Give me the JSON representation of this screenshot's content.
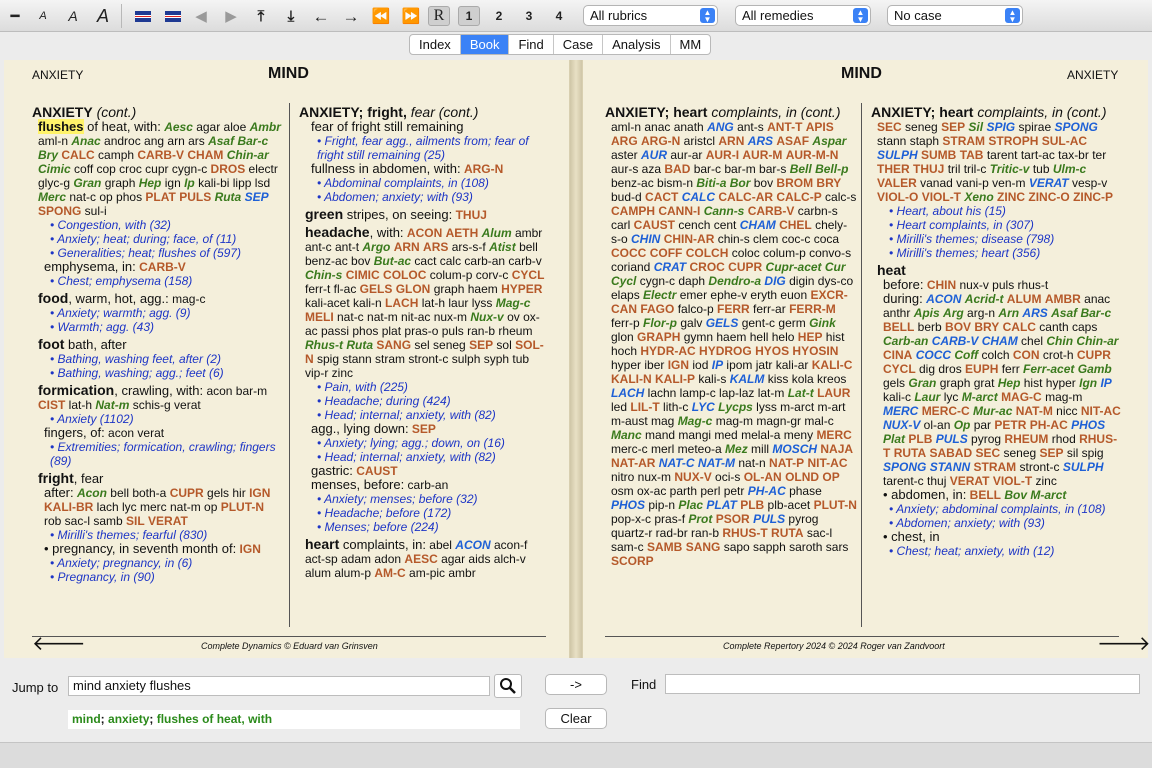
{
  "toolbar": {
    "sel_rubrics": "All rubrics",
    "sel_remedies": "All remedies",
    "sel_case": "No case",
    "nums": [
      "1",
      "2",
      "3",
      "4"
    ],
    "r_label": "R",
    "icons": [
      "minus-icon",
      "font-small-icon",
      "font-medium-icon",
      "font-large-icon",
      "flag-en-icon",
      "flag-en-alt-icon",
      "back-icon",
      "forward-icon",
      "top-icon",
      "bottom-icon",
      "left-arrow-icon",
      "right-arrow-icon",
      "double-left-icon",
      "double-right-icon"
    ]
  },
  "tabs": [
    "Index",
    "Book",
    "Find",
    "Case",
    "Analysis",
    "MM"
  ],
  "active_tab": "Book",
  "left_page": {
    "running_head": "ANXIETY",
    "title": "MIND",
    "footer": "Complete Dynamics © Eduard van Grinsven"
  },
  "right_page": {
    "running_head": "ANXIETY",
    "title": "MIND",
    "footer": "Complete Repertory 2024 © 2024 Roger van Zandvoort"
  },
  "cols": [
    [
      {
        "t": "rb",
        "head": "ANXIETY",
        "rest": " (cont.)",
        "ital": true
      },
      {
        "t": "rm",
        "hl": "flushes",
        "hltail": " of heat, with:",
        "text": "<g>Aesc</g> agar aloe <g>Ambr</g> aml-n <g>Anac</g> androc ang arn ars <g>Asaf</g> <g>Bar-c</g> <g>Bry</g> <r>CALC</r> camph <r>CARB-V</r> <r>CHAM</r> <g>Chin-ar</g> <g>Cimic</g> coff cop croc cupr cygn-c <r>DROS</r> electr glyc-g <g>Gran</g> graph <g>Hep</g> ign <g>Ip</g> kali-bi lipp lsd <g>Merc</g> nat-c op phos <r>PLAT</r> <r>PULS</r> <g>Ruta</g> <b>SEP</b> <r>SPONG</r> sul-i"
      },
      {
        "t": "ref",
        "text": "• Congestion, with (32)"
      },
      {
        "t": "ref",
        "text": "• Anxiety; heat; during; face, of (11)"
      },
      {
        "t": "ref",
        "text": "• Generalities; heat; flushes of (597)"
      },
      {
        "t": "sub",
        "lbl": "emphysema, in:",
        "text": "<r>CARB-V</r>"
      },
      {
        "t": "ref",
        "text": "• Chest; emphysema (158)"
      },
      {
        "t": "rub",
        "lbl": "food",
        "rest": ", warm, hot, agg.:",
        "text": "mag-c"
      },
      {
        "t": "ref",
        "text": "• Anxiety; warmth; agg. (9)"
      },
      {
        "t": "ref",
        "text": "• Warmth; agg. (43)"
      },
      {
        "t": "rub",
        "lbl": "foot",
        "rest": " bath, after",
        "text": ""
      },
      {
        "t": "ref",
        "text": "• Bathing, washing feet, after (2)"
      },
      {
        "t": "ref",
        "text": "• Bathing, washing; agg.; feet (6)"
      },
      {
        "t": "rub",
        "lbl": "formication",
        "rest": ", crawling, with:",
        "text": "acon bar-m <r>CIST</r> lat-h <g>Nat-m</g> schis-g verat"
      },
      {
        "t": "ref",
        "text": "• Anxiety (1102)"
      },
      {
        "t": "sub",
        "lbl": "fingers, of:",
        "text": "acon verat"
      },
      {
        "t": "ref",
        "text": "• Extremities; formication, crawling; fingers (89)"
      },
      {
        "t": "rub",
        "lbl": "fright",
        "rest": ", fear",
        "text": ""
      },
      {
        "t": "sub",
        "lbl": "after:",
        "text": "<g>Acon</g> bell both-a <r>CUPR</r> gels hir <r>IGN</r> <r>KALI-BR</r> lach lyc merc nat-m op <r>PLUT-N</r> rob sac-l samb <r>SIL</r> <r>VERAT</r>"
      },
      {
        "t": "ref",
        "text": "• Mirilli's themes; fearful (830)"
      },
      {
        "t": "sub",
        "lbl": "• pregnancy, in seventh month of:",
        "text": "<r>IGN</r>"
      },
      {
        "t": "ref",
        "text": "• Anxiety; pregnancy, in (6)"
      },
      {
        "t": "ref",
        "text": "• Pregnancy, in (90)"
      }
    ],
    [
      {
        "t": "rb",
        "head": "ANXIETY; fright,",
        "rest": " fear (cont.)",
        "ital": true
      },
      {
        "t": "sub",
        "lbl": "fear of fright still remaining",
        "text": ""
      },
      {
        "t": "ref",
        "text": "• Fright, fear agg., ailments from; fear of fright still remaining (25)"
      },
      {
        "t": "sub",
        "lbl": "fullness in abdomen, with:",
        "text": "<r>ARG-N</r>"
      },
      {
        "t": "ref",
        "text": "• Abdominal complaints, in (108)"
      },
      {
        "t": "ref",
        "text": "• Abdomen; anxiety; with (93)"
      },
      {
        "t": "rub",
        "lbl": "green",
        "rest": " stripes, on seeing:",
        "text": "<r>THUJ</r>"
      },
      {
        "t": "rub",
        "lbl": "headache",
        "rest": ", with:",
        "text": "<r>ACON</r> <r>AETH</r> <g>Alum</g> ambr ant-c ant-t <g>Argo</g> <r>ARN</r> <r>ARS</r> ars-s-f <g>Atist</g> bell benz-ac bov <g>But-ac</g> cact calc carb-an carb-v <g>Chin-s</g> <r>CIMIC</r> <r>COLOC</r> colum-p corv-c <r>CYCL</r> ferr-t fl-ac <r>GELS</r> <r>GLON</r> graph haem <r>HYPER</r> kali-acet kali-n <r>LACH</r> lat-h laur lyss <g>Mag-c</g> <r>MELI</r> nat-c nat-m nit-ac nux-m <g>Nux-v</g> ov ox-ac passi phos plat pras-o puls ran-b rheum <g>Rhus-t</g> <g>Ruta</g> <r>SANG</r> sel seneg <r>SEP</r> sol <r>SOL-N</r> spig stann stram stront-c sulph syph tub vip-r zinc"
      },
      {
        "t": "ref",
        "text": "• Pain, with (225)"
      },
      {
        "t": "ref",
        "text": "• Headache; during (424)"
      },
      {
        "t": "ref",
        "text": "• Head; internal; anxiety, with (82)"
      },
      {
        "t": "sub",
        "lbl": "agg., lying down:",
        "text": "<r>SEP</r>"
      },
      {
        "t": "ref",
        "text": "• Anxiety; lying; agg.; down, on (16)"
      },
      {
        "t": "ref",
        "text": "• Head; internal; anxiety, with (82)"
      },
      {
        "t": "sub",
        "lbl": "gastric:",
        "text": "<r>CAUST</r>"
      },
      {
        "t": "sub",
        "lbl": "menses, before:",
        "text": "carb-an"
      },
      {
        "t": "ref",
        "text": "• Anxiety; menses; before (32)"
      },
      {
        "t": "ref",
        "text": "• Headache; before (172)"
      },
      {
        "t": "ref",
        "text": "• Menses; before (224)"
      },
      {
        "t": "rub",
        "lbl": "heart",
        "rest": " complaints, in:",
        "text": "abel <b>ACON</b> acon-f act-sp adam adon <r>AESC</r> agar aids alch-v alum alum-p <r>AM-C</r> am-pic ambr"
      }
    ],
    [
      {
        "t": "rb",
        "head": "ANXIETY; heart",
        "rest": " complaints, in (cont.)",
        "ital": true
      },
      {
        "t": "rm",
        "text": "aml-n anac anath <b>ANG</b> ant-s <r>ANT-T</r> <r>APIS</r> <r>ARG</r> <r>ARG-N</r> aristcl <r>ARN</r> <b>ARS</b> <r>ASAF</r> <g>Aspar</g> aster <b>AUR</b> aur-ar <r>AUR-I</r> <r>AUR-M</r> <r>AUR-M-N</r> aur-s aza <r>BAD</r> bar-c bar-m bar-s <g>Bell</g> <g>Bell-p</g> benz-ac bism-n <g>Biti-a</g> <g>Bor</g> bov <r>BROM</r> <r>BRY</r> bud-d <r>CACT</r> <b>CALC</b> <r>CALC-AR</r> <r>CALC-P</r> calc-s <r>CAMPH</r> <r>CANN-I</r> <g>Cann-s</g> <r>CARB-V</r> carbn-s carl <r>CAUST</r> cench cent <b>CHAM</b> <r>CHEL</r> chely-s-o <b>CHIN</b> <r>CHIN-AR</r> chin-s clem coc-c coca <r>COCC</r> <r>COFF</r> <r>COLCH</r> coloc colum-p convo-s coriand <b>CRAT</b> <r>CROC</r> <r>CUPR</r> <g>Cupr-acet</g> <g>Cur</g> <g>Cycl</g> cygn-c daph <g>Dendro-a</g> <b>DIG</b> digin dys-co elaps <g>Electr</g> emer ephe-v eryth euon <r>EXCR-CAN</r> <r>FAGO</r> falco-p <r>FERR</r> ferr-ar <r>FERR-M</r> ferr-p <g>Flor-p</g> galv <b>GELS</b> gent-c germ <g>Gink</g> glon <r>GRAPH</r> gymn haem hell helo <r>HEP</r> hist hoch <r>HYDR-AC</r> <r>HYDROG</r> <r>HYOS</r> <r>HYOSIN</r> hyper iber <r>IGN</r> iod <b>IP</b> ipom jatr kali-ar <r>KALI-C</r> <r>KALI-N</r> <r>KALI-P</r> kali-s <b>KALM</b> kiss kola kreos <b>LACH</b> lachn lamp-c lap-laz lat-m <g>Lat-t</g> <r>LAUR</r> led <r>LIL-T</r> lith-c <b>LYC</b> <g>Lycps</g> lyss m-arct m-art m-aust mag <g>Mag-c</g> mag-m magn-gr mal-c <g>Manc</g> mand mangi med melal-a meny <r>MERC</r> merc-c merl meteo-a <g>Mez</g> mill <b>MOSCH</b> <r>NAJA</r> <r>NAT-AR</r> <b>NAT-C</b> <b>NAT-M</b> nat-n <r>NAT-P</r> <r>NIT-AC</r> nitro nux-m <r>NUX-V</r> oci-s <r>OL-AN</r> <r>OLND</r> <r>OP</r> osm ox-ac parth perl petr <b>PH-AC</b> phase <b>PHOS</b> pip-n <g>Plac</g> <b>PLAT</b> <r>PLB</r> plb-acet <r>PLUT-N</r> pop-x-c pras-f <g>Prot</g> <r>PSOR</r> <b>PULS</b> pyrog quartz-r rad-br ran-b <r>RHUS-T</r> <r>RUTA</r> sac-l sam-c <r>SAMB</r> <r>SANG</r> sapo sapph saroth sars <r>SCORP</r>"
      }
    ],
    [
      {
        "t": "rb",
        "head": "ANXIETY; heart",
        "rest": " complaints, in (cont.)",
        "ital": true
      },
      {
        "t": "rm",
        "text": "<r>SEC</r> seneg <r>SEP</r> <g>Sil</g> <b>SPIG</b> spirae <b>SPONG</b> stann staph <r>STRAM</r> <r>STROPH</r> <r>SUL-AC</r> <b>SULPH</b> <r>SUMB</r> <r>TAB</r> tarent tart-ac tax-br ter <r>THER</r> <r>THUJ</r> tril tril-c <g>Tritic-v</g> tub <g>Ulm-c</g> <r>VALER</r> vanad vani-p ven-m <b>VERAT</b> vesp-v <r>VIOL-O</r> <r>VIOL-T</r> <g>Xeno</g> <r>ZINC</r> <r>ZINC-O</r> <r>ZINC-P</r>"
      },
      {
        "t": "ref",
        "text": "• Heart, about his (15)"
      },
      {
        "t": "ref",
        "text": "• Heart complaints, in (307)"
      },
      {
        "t": "ref",
        "text": "• Mirilli's themes; disease (798)"
      },
      {
        "t": "ref",
        "text": "• Mirilli's themes; heart (356)"
      },
      {
        "t": "rub",
        "lbl": "heat",
        "rest": "",
        "text": ""
      },
      {
        "t": "sub",
        "lbl": "before:",
        "text": "<r>CHIN</r> nux-v puls rhus-t"
      },
      {
        "t": "sub",
        "lbl": "during:",
        "text": "<b>ACON</b> <g>Acrid-t</g> <r>ALUM</r> <r>AMBR</r> anac anthr <g>Apis</g> <g>Arg</g> arg-n <g>Arn</g> <b>ARS</b> <g>Asaf</g> <g>Bar-c</g> <r>BELL</r> berb <r>BOV</r> <r>BRY</r> <r>CALC</r> canth caps <g>Carb-an</g> <b>CARB-V</b> <b>CHAM</b> chel <g>Chin</g> <g>Chin-ar</g> <r>CINA</r> <b>COCC</b> <g>Coff</g> colch <r>CON</r> crot-h <r>CUPR</r> <r>CYCL</r> dig dros <r>EUPH</r> ferr <g>Ferr-acet</g> <g>Gamb</g> gels <g>Gran</g> graph grat <g>Hep</g> hist hyper <g>Ign</g> <b>IP</b> kali-c <g>Laur</g> lyc <g>M-arct</g> <r>MAG-C</r> mag-m <b>MERC</b> <r>MERC-C</r> <g>Mur-ac</g> <r>NAT-M</r> nicc <r>NIT-AC</r> <b>NUX-V</b> ol-an <g>Op</g> par <r>PETR</r> <r>PH-AC</r> <b>PHOS</b> <g>Plat</g> <r>PLB</r> <b>PULS</b> pyrog <r>RHEUM</r> rhod <r>RHUS-T</r> <r>RUTA</r> <r>SABAD</r> <r>SEC</r> seneg <r>SEP</r> sil spig <b>SPONG</b> <b>STANN</b> <r>STRAM</r> stront-c <b>SULPH</b> tarent-c thuj <r>VERAT</r> <r>VIOL-T</r> zinc"
      },
      {
        "t": "sub",
        "lbl": "• abdomen, in:",
        "text": "<r>BELL</r> <g>Bov</g> <g>M-arct</g>"
      },
      {
        "t": "ref",
        "text": "• Anxiety; abdominal complaints, in (108)"
      },
      {
        "t": "ref",
        "text": "• Abdomen; anxiety; with (93)"
      },
      {
        "t": "sub",
        "lbl": "• chest, in",
        "text": ""
      },
      {
        "t": "ref",
        "text": "• Chest; heat; anxiety, with (12)"
      }
    ]
  ],
  "bottom": {
    "jump_label": "Jump to",
    "jump_value": "mind anxiety flushes",
    "arrow_btn": "->",
    "clear_btn": "Clear",
    "find_label": "Find",
    "find_value": "",
    "suggestion": [
      "mind",
      "; ",
      "anxiety",
      "; ",
      "flushes of heat, with"
    ]
  },
  "colors": {
    "remedy_bold": "#b5592a",
    "remedy_green": "#3a7a1d",
    "remedy_blue": "#1e60d6",
    "ref_blue": "#1d35c6",
    "highlight": "#fff36a",
    "tab_active": "#3b82f6"
  }
}
